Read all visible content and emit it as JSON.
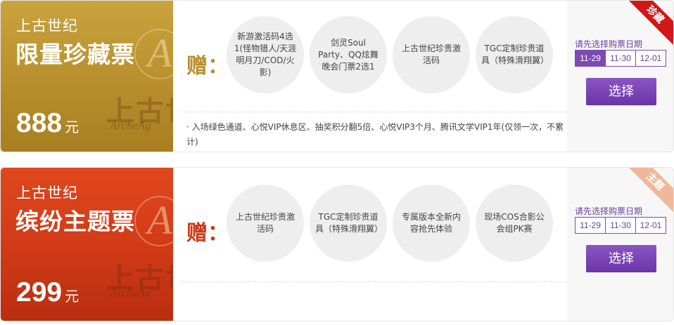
{
  "tickets": [
    {
      "game": "上古世纪",
      "title": "限量珍藏票",
      "price": "888",
      "unit": "元",
      "logo_text": "上古世",
      "logo_en": "ArcheAg",
      "gift_label": "赠：",
      "gifts": [
        "新游激活码4选1(怪物猎人/天涯明月刀/COD/火影)",
        "剑灵Soul Party、QQ炫舞晚会门票2选1",
        "上古世纪珍贵激活码",
        "TGC定制珍贵道具（特殊滑翔翼）"
      ],
      "benefits": "· 入场绿色通道、心悦VIP休息区、抽奖积分翻5倍、心悦VIP3个月、腾讯文学VIP1年(仅领一次，不累计)",
      "hint": "请先选择购票日期",
      "dates": [
        "11-29",
        "11-30",
        "12-01"
      ],
      "active_date": "11-29",
      "select_label": "选择",
      "ribbon": "珍藏"
    },
    {
      "game": "上古世纪",
      "title": "缤纷主题票",
      "price": "299",
      "unit": "元",
      "logo_text": "上古世",
      "logo_en": "ArcheAg",
      "gift_label": "赠：",
      "gifts": [
        "上古世纪珍贵激活码",
        "TGC定制珍贵道具（特殊滑翔翼）",
        "专属版本全新内容抢先体验",
        "现场COS合影公会组PK赛"
      ],
      "benefits": "",
      "hint": "请先选择购票日期",
      "dates": [
        "11-29",
        "11-30",
        "12-01"
      ],
      "active_date": "",
      "select_label": "选择",
      "ribbon": "主题"
    }
  ]
}
